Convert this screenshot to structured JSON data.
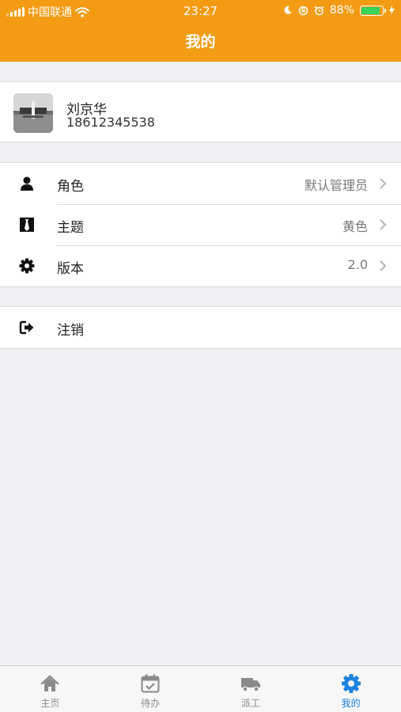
{
  "status_bar": {
    "carrier": "中国联通",
    "time": "23:27",
    "battery_percent": "88%",
    "battery_level": 0.88
  },
  "header": {
    "title": "我的"
  },
  "profile": {
    "name": "刘京华",
    "phone": "18612345538"
  },
  "settings": [
    {
      "label": "角色",
      "value": "默认管理员",
      "icon": "person-icon"
    },
    {
      "label": "主题",
      "value": "黄色",
      "icon": "tie-icon"
    },
    {
      "label": "版本",
      "value": "2.0",
      "icon": "gear-icon"
    }
  ],
  "logout": {
    "label": "注销",
    "icon": "logout-icon"
  },
  "tabbar": {
    "tabs": [
      {
        "label": "主页",
        "icon": "home-icon"
      },
      {
        "label": "待办",
        "icon": "calendar-check-icon"
      },
      {
        "label": "派工",
        "icon": "truck-icon"
      },
      {
        "label": "我的",
        "icon": "gear-icon"
      }
    ],
    "active_index": 3
  },
  "colors": {
    "header": "#f29b13",
    "tab_active": "#1a82e0",
    "battery": "#37d35a"
  }
}
